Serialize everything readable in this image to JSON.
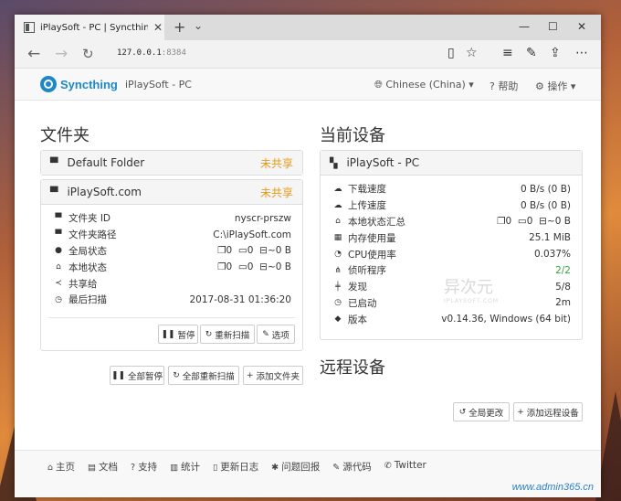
{
  "browser": {
    "tab_title": "iPlaySoft - PC | Syncthin",
    "url_host": "127.0.0.1",
    "url_port": ":8384"
  },
  "appnav": {
    "logo_text": "Syncthing",
    "device_name": "iPlaySoft - PC",
    "language": "Chinese (China)",
    "help": "帮助",
    "actions": "操作"
  },
  "folders": {
    "title": "文件夹",
    "default_folder": {
      "name": "Default Folder",
      "status": "未共享"
    },
    "iplaysoft": {
      "name": "iPlaySoft.com",
      "status": "未共享",
      "rows": [
        {
          "label": "文件夹 ID",
          "value": "nyscr-prszw"
        },
        {
          "label": "文件夹路径",
          "value": "C:\\iPlaySoft.com"
        },
        {
          "label": "全局状态",
          "files": "0",
          "dirs": "0",
          "size": "~0 B"
        },
        {
          "label": "本地状态",
          "files": "0",
          "dirs": "0",
          "size": "~0 B"
        },
        {
          "label": "共享给",
          "value": ""
        },
        {
          "label": "最后扫描",
          "value": "2017-08-31 01:36:20"
        }
      ],
      "btn_pause": "暂停",
      "btn_rescan": "重新扫描",
      "btn_options": "选项"
    },
    "btn_pause_all": "全部暂停",
    "btn_rescan_all": "全部重新扫描",
    "btn_add_folder": "添加文件夹"
  },
  "this_device": {
    "title": "当前设备",
    "name": "iPlaySoft - PC",
    "rows": [
      {
        "label": "下载速度",
        "value": "0 B/s (0 B)"
      },
      {
        "label": "上传速度",
        "value": "0 B/s (0 B)"
      },
      {
        "label": "本地状态汇总",
        "files": "0",
        "dirs": "0",
        "size": "~0 B"
      },
      {
        "label": "内存使用量",
        "value": "25.1 MiB"
      },
      {
        "label": "CPU使用率",
        "value": "0.037%"
      },
      {
        "label": "侦听程序",
        "value": "2/2"
      },
      {
        "label": "发现",
        "value": "5/8"
      },
      {
        "label": "已启动",
        "value": "2m"
      },
      {
        "label": "版本",
        "value": "v0.14.36, Windows (64 bit)"
      }
    ]
  },
  "remote_devices": {
    "title": "远程设备",
    "btn_global_changes": "全局更改",
    "btn_add_remote": "添加远程设备"
  },
  "footer": {
    "links": [
      "主页",
      "文档",
      "支持",
      "统计",
      "更新日志",
      "问题回报",
      "源代码",
      "Twitter"
    ],
    "watermark": "www.admin365.cn"
  },
  "overlay": {
    "wm_cn": "异次元",
    "wm_en": "IPLAYSOFT.COM"
  },
  "colors": {
    "accent": "#1e88c7",
    "unshared": "#e69a1a",
    "ok": "#2eaa3c"
  }
}
